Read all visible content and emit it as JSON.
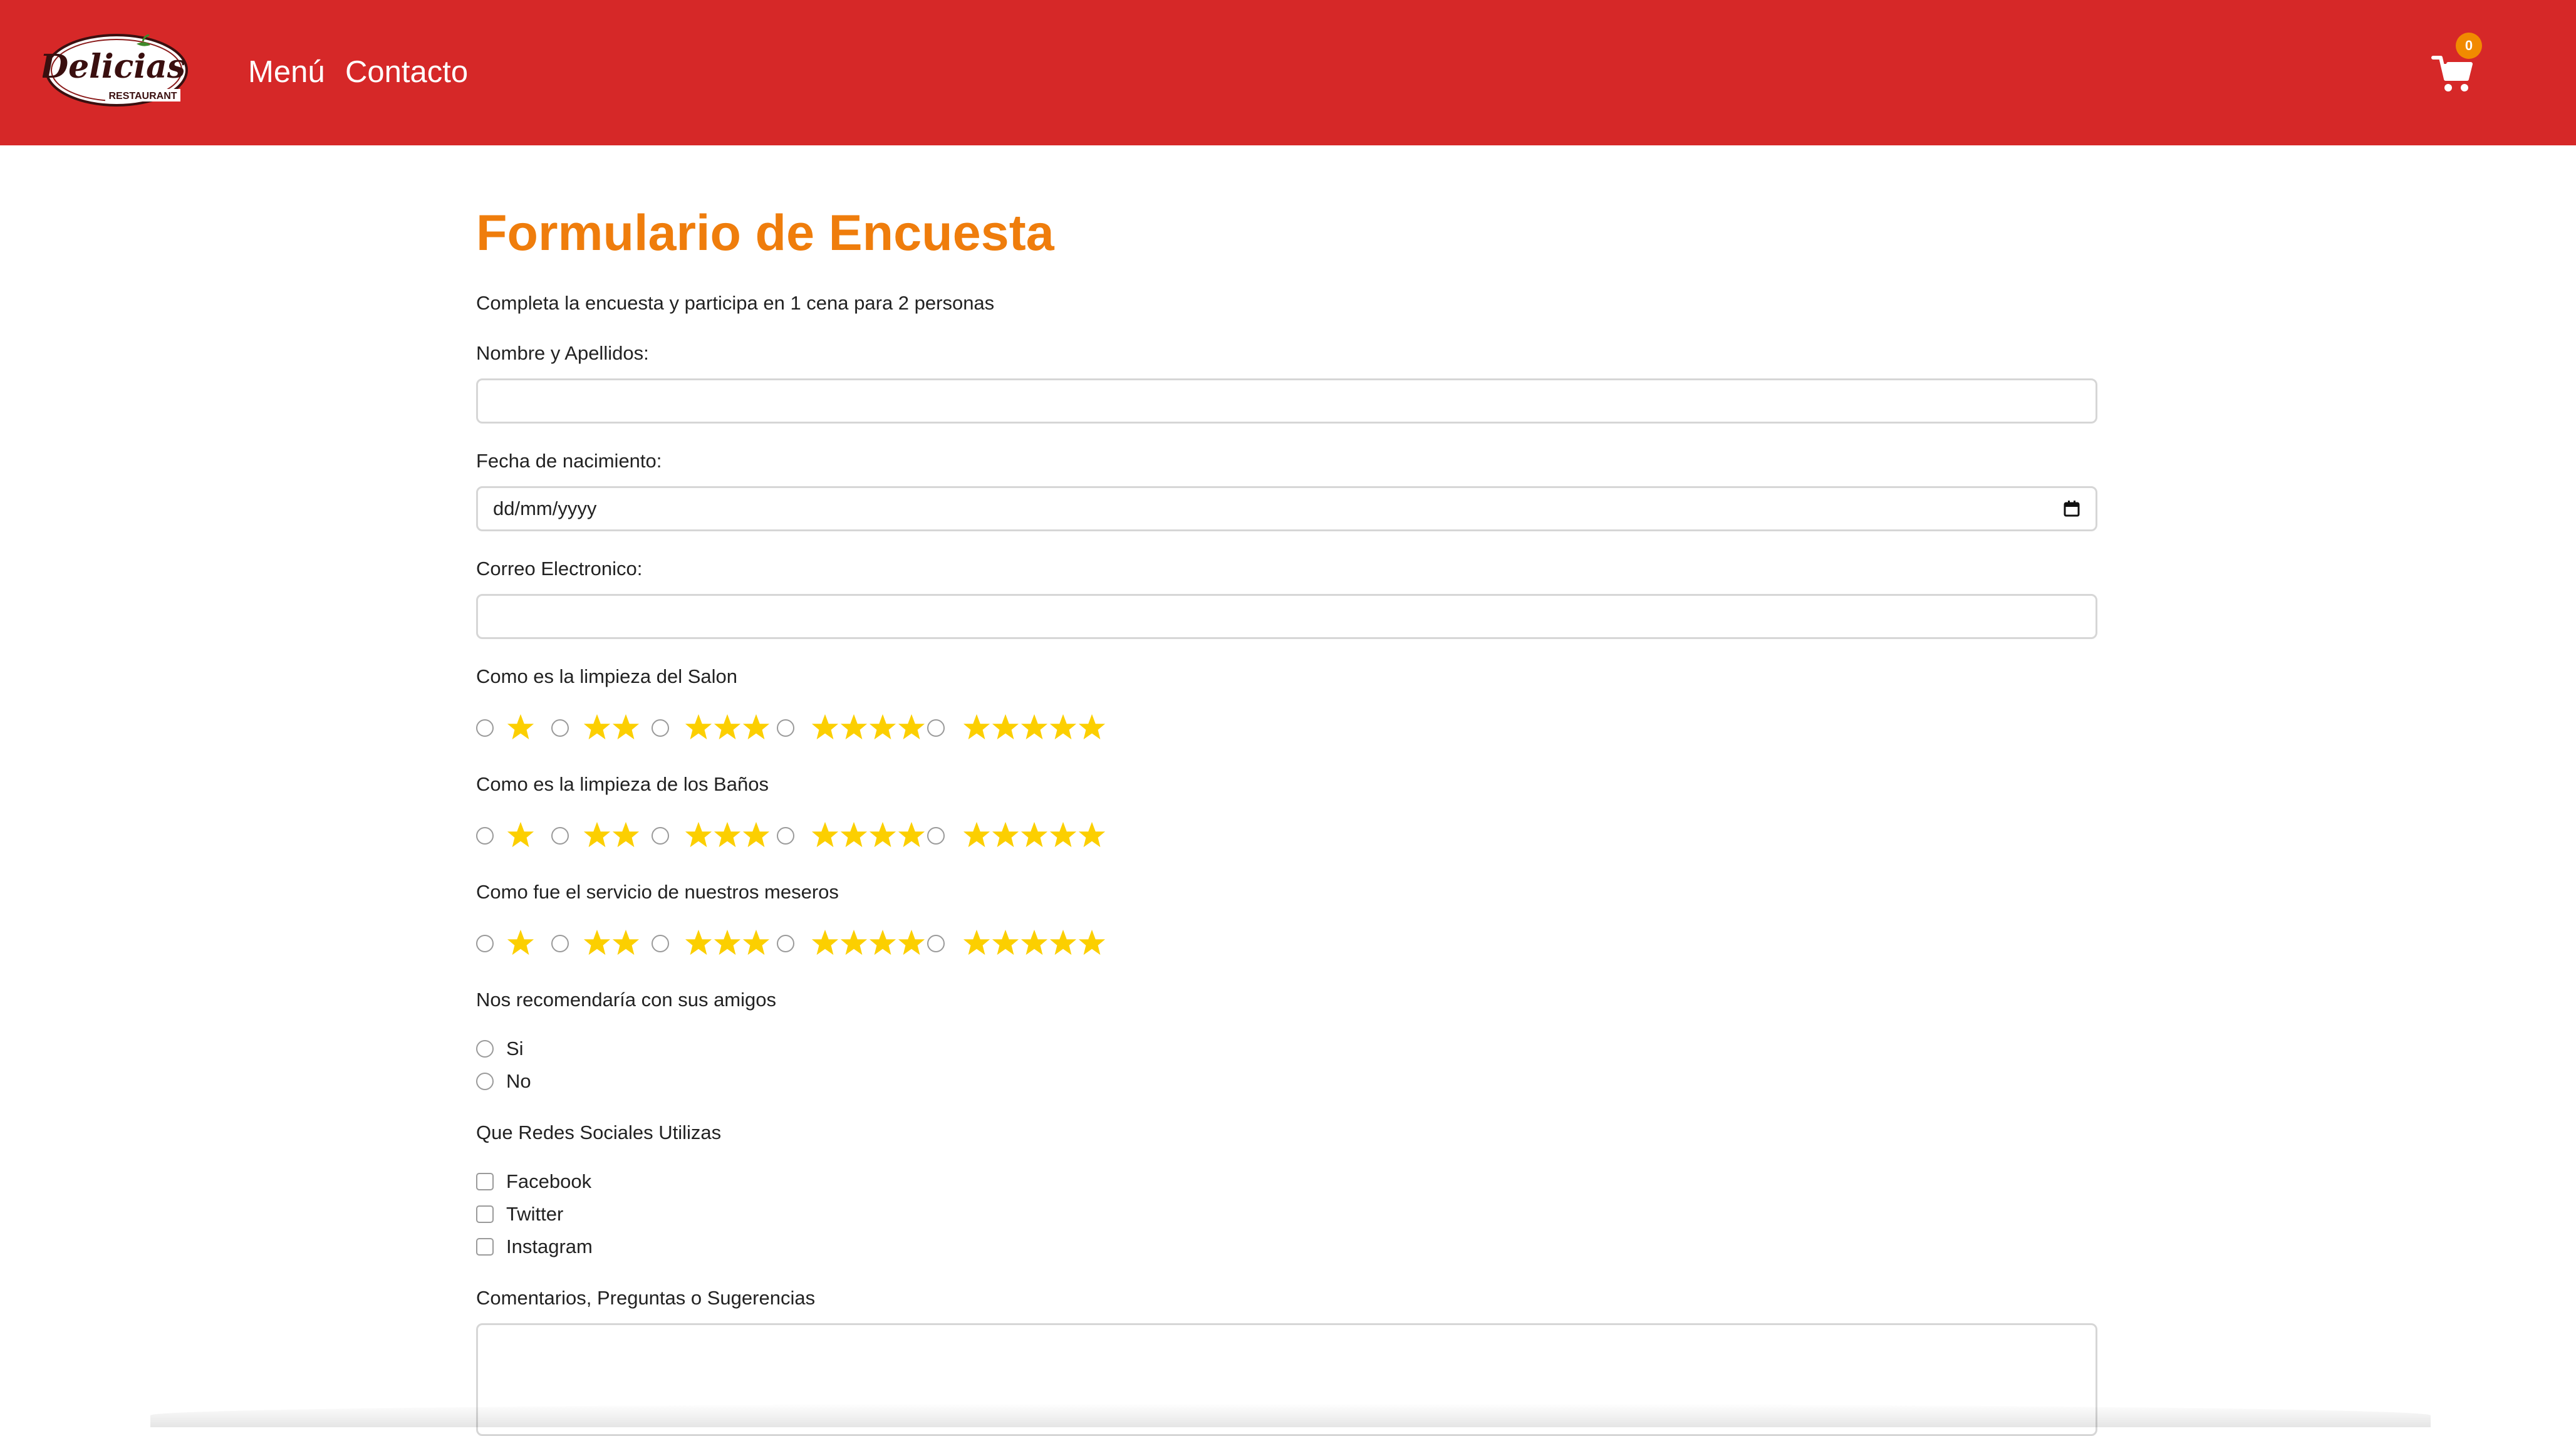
{
  "header": {
    "logo_text": "Delicias",
    "logo_subtext": "RESTAURANT",
    "nav": {
      "menu_label": "Menú",
      "contact_label": "Contacto"
    },
    "cart_count": "0",
    "colors": {
      "background": "#d62828",
      "badge": "#f18a00",
      "text": "#ffffff"
    }
  },
  "form": {
    "title": "Formulario de Encuesta",
    "intro": "Completa la encuesta y participa en 1 cena para 2 personas",
    "name_label": "Nombre y Apellidos:",
    "birth_label": "Fecha de nacimiento:",
    "birth_placeholder": "dd/mm/yyyy",
    "email_label": "Correo Electronico:",
    "rating_questions": [
      {
        "label": "Como es la limpieza del Salon",
        "options": [
          1,
          2,
          3,
          4,
          5
        ]
      },
      {
        "label": "Como es la limpieza de los Baños",
        "options": [
          1,
          2,
          3,
          4,
          5
        ]
      },
      {
        "label": "Como fue el servicio de nuestros meseros",
        "options": [
          1,
          2,
          3,
          4,
          5
        ]
      }
    ],
    "recommend": {
      "label": "Nos recomendaría con sus amigos",
      "options": [
        "Si",
        "No"
      ]
    },
    "social": {
      "label": "Que Redes Sociales Utilizas",
      "options": [
        "Facebook",
        "Twitter",
        "Instagram"
      ]
    },
    "comments_label": "Comentarios, Preguntas o Sugerencias",
    "colors": {
      "title": "#ef7d0c",
      "stars": "#fccf00"
    },
    "icons": {
      "rating": "star-icon",
      "calendar": "calendar-icon",
      "cart": "cart-icon"
    }
  }
}
